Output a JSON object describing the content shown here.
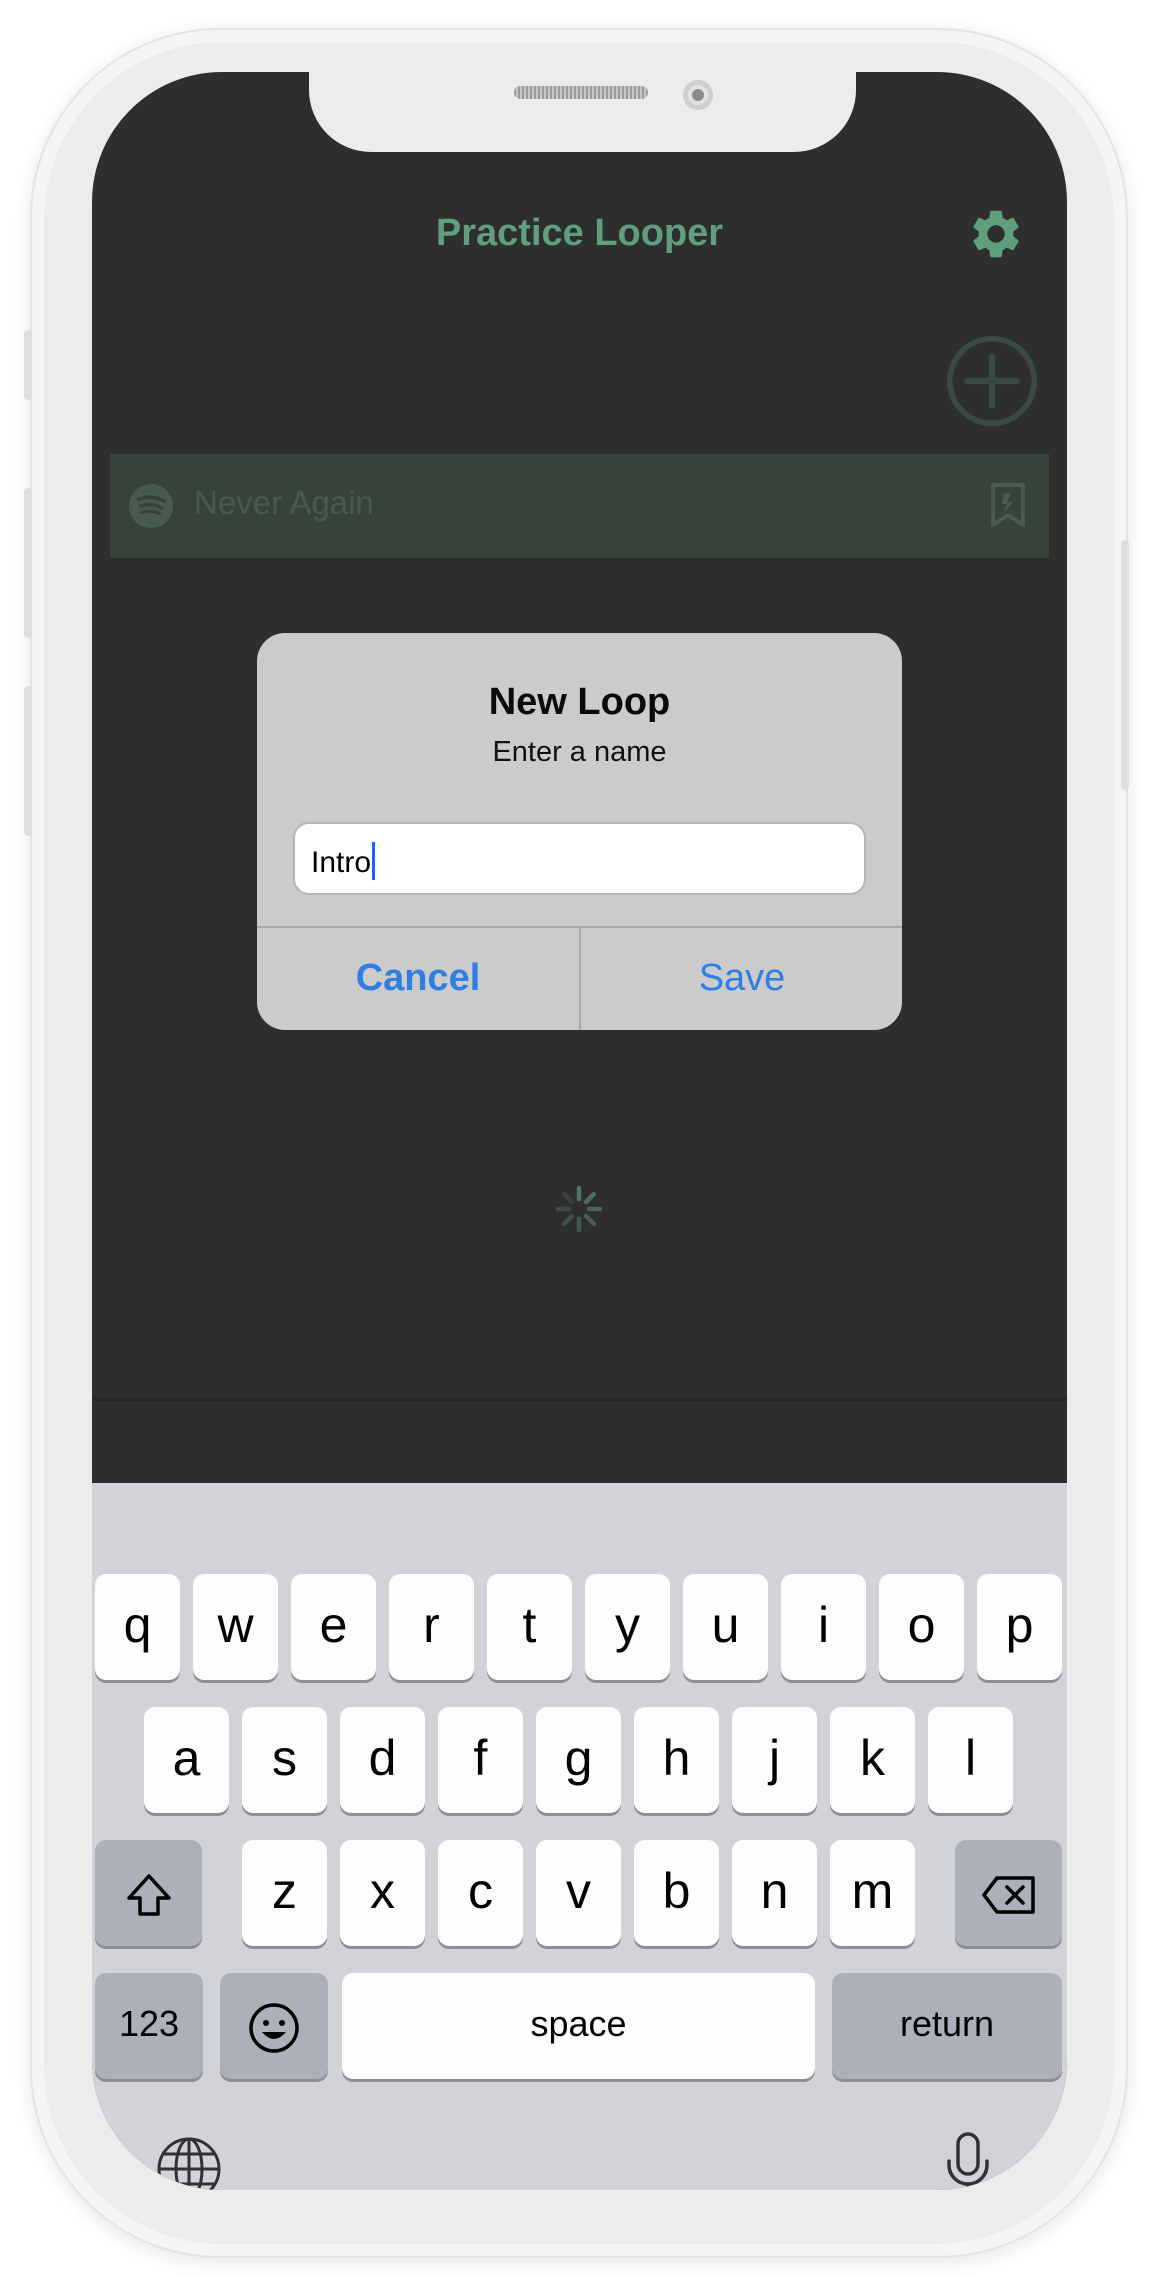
{
  "app": {
    "title": "Practice Looper"
  },
  "song_list": {
    "items": [
      {
        "title": "Never Again",
        "source_icon": "spotify-icon"
      }
    ]
  },
  "dialog": {
    "title": "New Loop",
    "message": "Enter a name",
    "input_value": "Intro",
    "cancel_label": "Cancel",
    "save_label": "Save"
  },
  "keyboard": {
    "row1": [
      "q",
      "w",
      "e",
      "r",
      "t",
      "y",
      "u",
      "i",
      "o",
      "p"
    ],
    "row2": [
      "a",
      "s",
      "d",
      "f",
      "g",
      "h",
      "j",
      "k",
      "l"
    ],
    "row3": [
      "z",
      "x",
      "c",
      "v",
      "b",
      "n",
      "m"
    ],
    "numbers_label": "123",
    "space_label": "space",
    "return_label": "return"
  },
  "colors": {
    "accent_green": "#5f9f7e",
    "screen_background": "#2e2e2e",
    "dialog_button_blue": "#2f7ee6",
    "keyboard_background": "#d1d3d9"
  }
}
